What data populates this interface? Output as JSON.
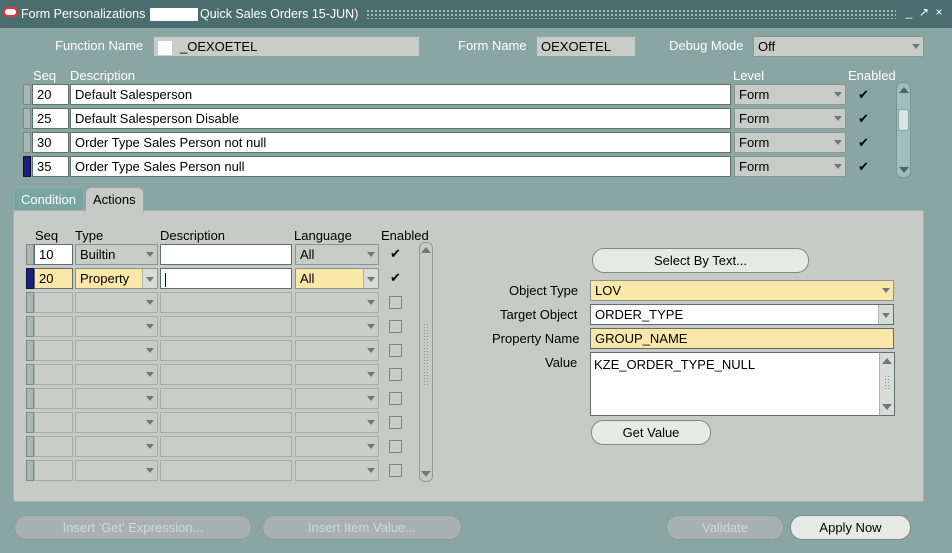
{
  "window": {
    "title_prefix": "Form Personalizations",
    "title_suffix": "Quick Sales Orders 15-JUN)"
  },
  "header": {
    "function_name_label": "Function Name",
    "function_name_value": "_OEXOETEL",
    "form_name_label": "Form Name",
    "form_name_value": "OEXOETEL",
    "debug_mode_label": "Debug Mode",
    "debug_mode_value": "Off"
  },
  "rules": {
    "col_seq": "Seq",
    "col_description": "Description",
    "col_level": "Level",
    "col_enabled": "Enabled",
    "rows": [
      {
        "seq": "20",
        "description": "Default Salesperson",
        "level": "Form",
        "enabled": "✔"
      },
      {
        "seq": "25",
        "description": "Default Salesperson Disable",
        "level": "Form",
        "enabled": "✔"
      },
      {
        "seq": "30",
        "description": "Order Type Sales Person not null",
        "level": "Form",
        "enabled": "✔"
      },
      {
        "seq": "35",
        "description": "Order Type Sales Person null",
        "level": "Form",
        "enabled": "✔"
      }
    ]
  },
  "tabs": {
    "condition": "Condition",
    "actions": "Actions"
  },
  "actions": {
    "col_seq": "Seq",
    "col_type": "Type",
    "col_description": "Description",
    "col_language": "Language",
    "col_enabled": "Enabled",
    "rows": [
      {
        "seq": "10",
        "type": "Builtin",
        "description": "",
        "language": "All",
        "enabled": "✔"
      },
      {
        "seq": "20",
        "type": "Property",
        "description": "",
        "language": "All",
        "enabled": "✔"
      }
    ]
  },
  "detail": {
    "select_by_text": "Select By Text...",
    "object_type_label": "Object Type",
    "object_type_value": "LOV",
    "target_object_label": "Target Object",
    "target_object_value": "ORDER_TYPE",
    "property_name_label": "Property Name",
    "property_name_value": "GROUP_NAME",
    "value_label": "Value",
    "value_value": "KZE_ORDER_TYPE_NULL",
    "get_value": "Get Value"
  },
  "footer": {
    "insert_get_expression": "Insert 'Get' Expression...",
    "insert_item_value": "Insert Item Value...",
    "validate": "Validate",
    "apply_now": "Apply Now"
  },
  "colors": {
    "background": "#8aa6a2",
    "titlebar": "#4a6d70",
    "required_field": "#fbe8a8",
    "panel": "#c7cbc8"
  }
}
